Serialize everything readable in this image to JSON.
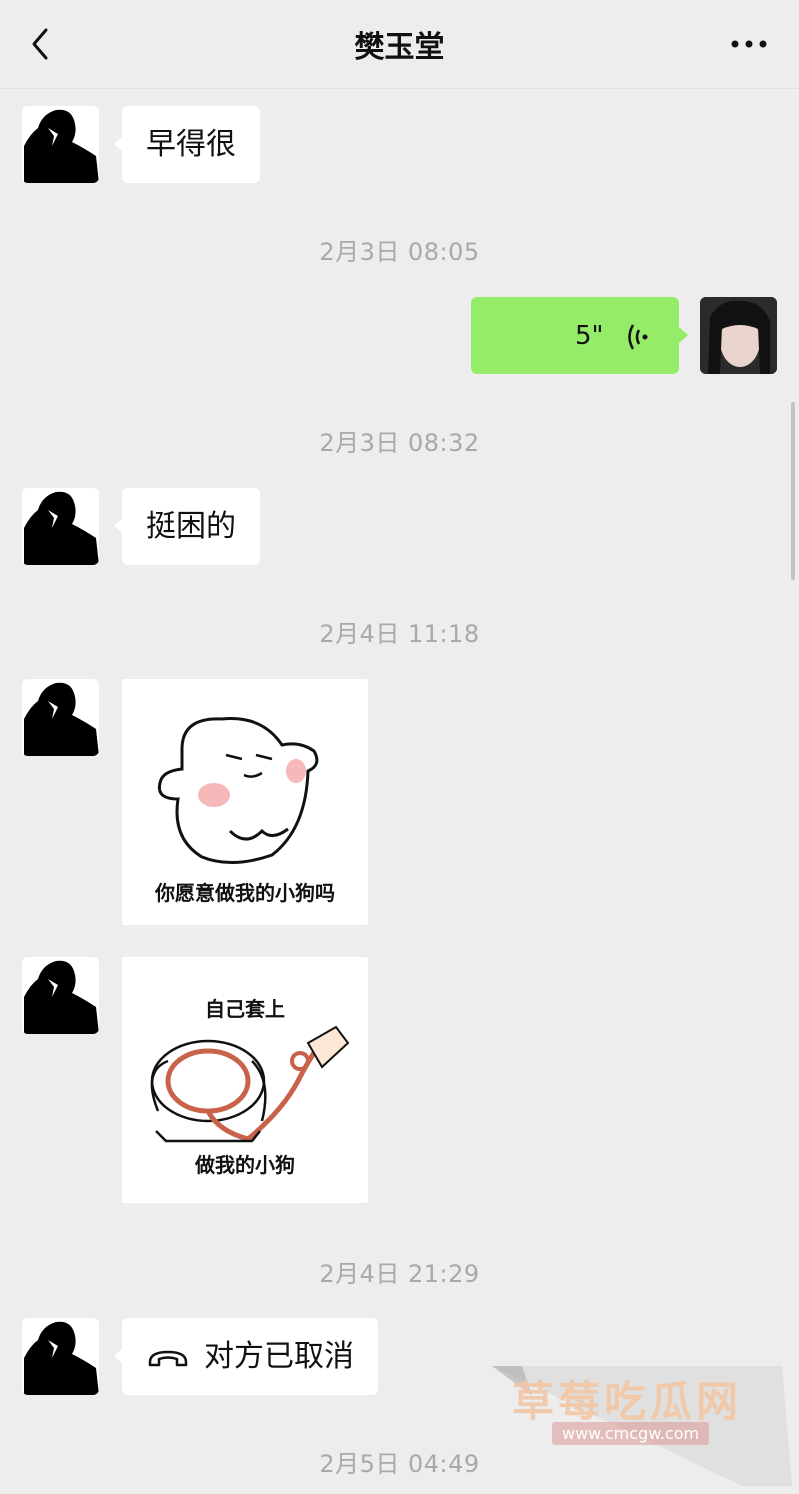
{
  "header": {
    "title": "樊玉堂",
    "back_icon": "chevron-left-icon",
    "more_icon": "more-dots-icon"
  },
  "messages": {
    "m1_text": "早得很",
    "t1": "2月3日 08:05",
    "voice_length": "5\"",
    "t2": "2月3日 08:32",
    "m2_text": "挺困的",
    "t3": "2月4日 11:18",
    "sticker1_caption": "你愿意做我的小狗吗",
    "sticker2_top": "自己套上",
    "sticker2_bottom": "做我的小狗",
    "t4": "2月4日 21:29",
    "call_text": "对方已取消",
    "t5": "2月5日 04:49"
  },
  "watermark": {
    "title": "草莓吃瓜网",
    "url": "www.cmcgw.com"
  },
  "colors": {
    "background": "#ededed",
    "voice_bubble": "#95ec69",
    "timestamp": "#a9a9a9"
  }
}
